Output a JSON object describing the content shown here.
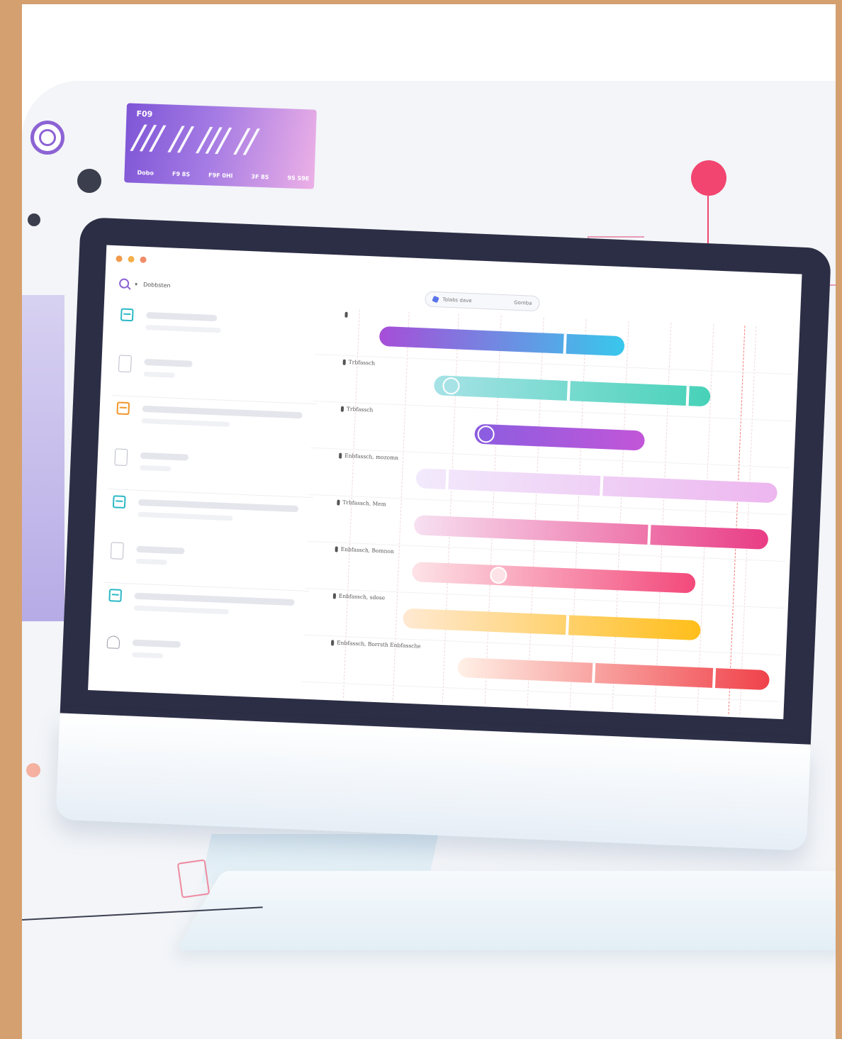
{
  "card": {
    "code": "F09",
    "marks": "/// // /// //",
    "ticks": [
      "Dobo",
      "F9 8S",
      "F9F 0Hl",
      "3F 8S",
      "9S S9E"
    ]
  },
  "app": {
    "breadcrumb": "Dobbsten",
    "search_text": "Tolabs dave",
    "search_right": "Gomba"
  },
  "tasks": [
    {
      "icon": "teal-board-icon"
    },
    {
      "icon": "document-icon"
    },
    {
      "icon": "orange-board-icon"
    },
    {
      "icon": "document-icon"
    },
    {
      "icon": "teal-board-icon"
    },
    {
      "icon": "document-icon"
    },
    {
      "icon": "teal-board-icon"
    },
    {
      "icon": "user-icon"
    }
  ],
  "gantt": {
    "rows": [
      {
        "label": "",
        "color_from": "#a64ed8",
        "color_to": "#38c8ec"
      },
      {
        "label": "Trbfassch",
        "color_from": "#a6e2e6",
        "color_to": "#47d2b8"
      },
      {
        "label": "Trbfassch",
        "color_from": "#8c5de0",
        "color_to": "#c256d8"
      },
      {
        "label": "Enbfassch, mozomn",
        "color_from": "#f2eafc",
        "color_to": "#edb6ef"
      },
      {
        "label": "Trbfassch, Mem",
        "color_from": "#f7e0f1",
        "color_to": "#e93c85"
      },
      {
        "label": "Enbfassch, Bomnon",
        "color_from": "#fde3e7",
        "color_to": "#f3497b"
      },
      {
        "label": "Enbfassch, sdose",
        "color_from": "#ffe9d2",
        "color_to": "#ffbe1a"
      },
      {
        "label": "Enbfassch, Borrsth Enbfassche",
        "color_from": "#fff0e6",
        "color_to": "#f0424a"
      }
    ]
  },
  "colors": {
    "accent": "#8c63d4",
    "pink": "#f2456f",
    "bezel": "#2c2e45"
  }
}
